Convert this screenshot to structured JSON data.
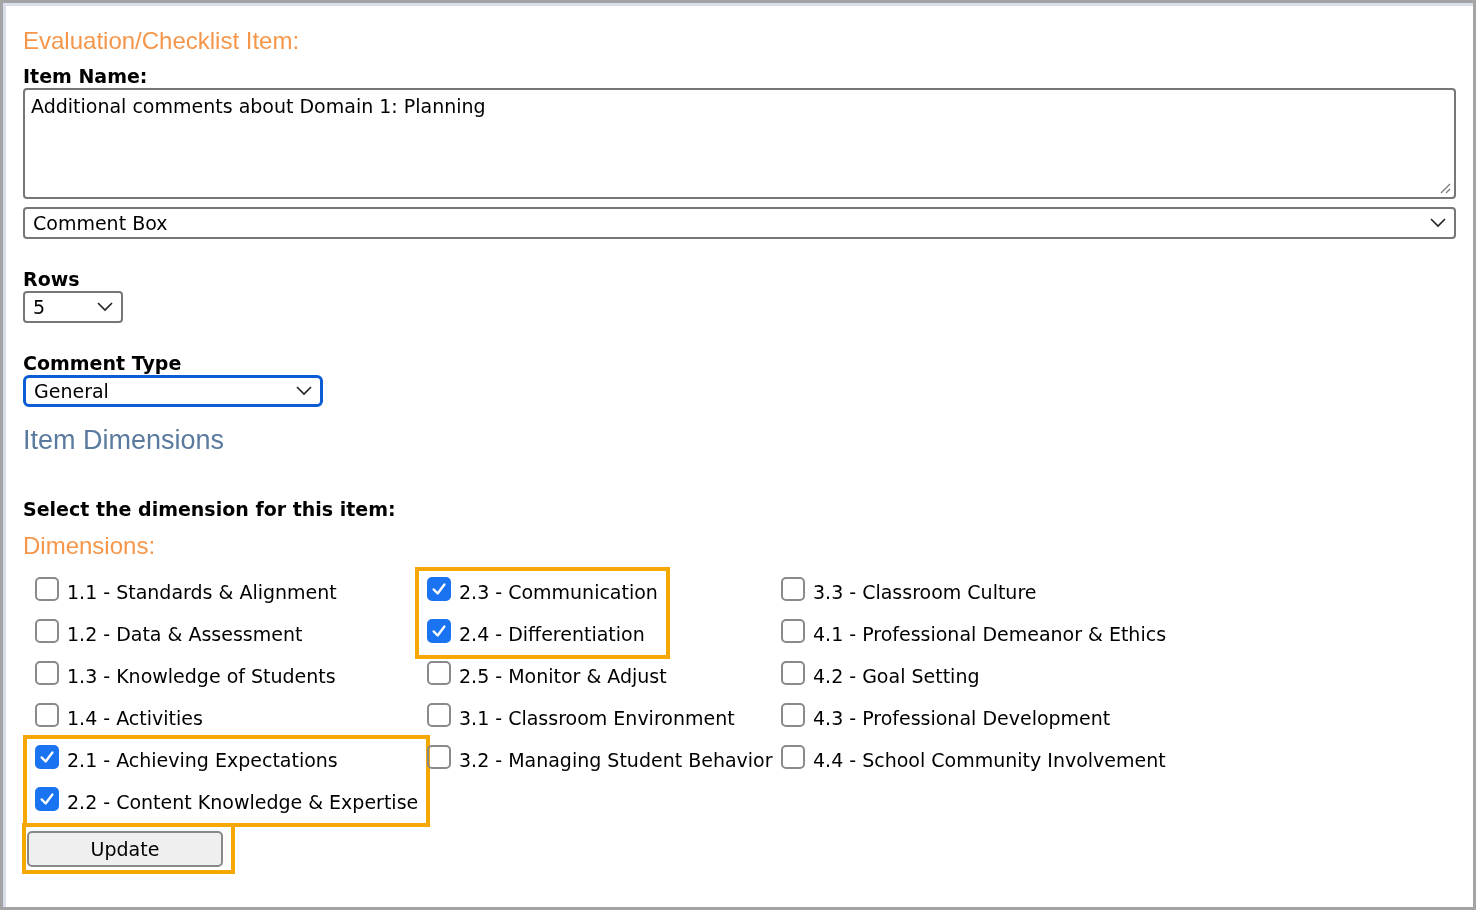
{
  "heading": "Evaluation/Checklist Item:",
  "item_name": {
    "label": "Item Name:",
    "value": "Additional comments about Domain 1: Planning"
  },
  "item_type": {
    "value": "Comment Box"
  },
  "rows": {
    "label": "Rows",
    "value": "5"
  },
  "comment_type": {
    "label": "Comment Type",
    "value": "General",
    "focused": true
  },
  "section_title": "Item Dimensions",
  "instruction": "Select the dimension for this item:",
  "dimensions": {
    "title": "Dimensions:",
    "columns": [
      {
        "items": [
          {
            "label": "1.1 - Standards & Alignment",
            "checked": false,
            "highlighted": false
          },
          {
            "label": "1.2 - Data & Assessment",
            "checked": false,
            "highlighted": false
          },
          {
            "label": "1.3 - Knowledge of Students",
            "checked": false,
            "highlighted": false
          },
          {
            "label": "1.4 - Activities",
            "checked": false,
            "highlighted": false
          },
          {
            "label": "2.1 - Achieving Expectations",
            "checked": true,
            "highlighted": true
          },
          {
            "label": "2.2 - Content Knowledge & Expertise",
            "checked": true,
            "highlighted": true
          }
        ]
      },
      {
        "items": [
          {
            "label": "2.3 - Communication",
            "checked": true,
            "highlighted": true
          },
          {
            "label": "2.4 - Differentiation",
            "checked": true,
            "highlighted": true
          },
          {
            "label": "2.5 - Monitor & Adjust",
            "checked": false,
            "highlighted": false
          },
          {
            "label": "3.1 - Classroom Environment",
            "checked": false,
            "highlighted": false
          },
          {
            "label": "3.2 - Managing Student Behavior",
            "checked": false,
            "highlighted": false
          }
        ]
      },
      {
        "items": [
          {
            "label": "3.3 - Classroom Culture",
            "checked": false,
            "highlighted": false
          },
          {
            "label": "4.1 - Professional Demeanor & Ethics",
            "checked": false,
            "highlighted": false
          },
          {
            "label": "4.2 - Goal Setting",
            "checked": false,
            "highlighted": false
          },
          {
            "label": "4.3 - Professional Development",
            "checked": false,
            "highlighted": false
          },
          {
            "label": "4.4 - School Community Involvement",
            "checked": false,
            "highlighted": false
          }
        ]
      }
    ]
  },
  "update_button": {
    "label": "Update",
    "highlighted": true
  }
}
